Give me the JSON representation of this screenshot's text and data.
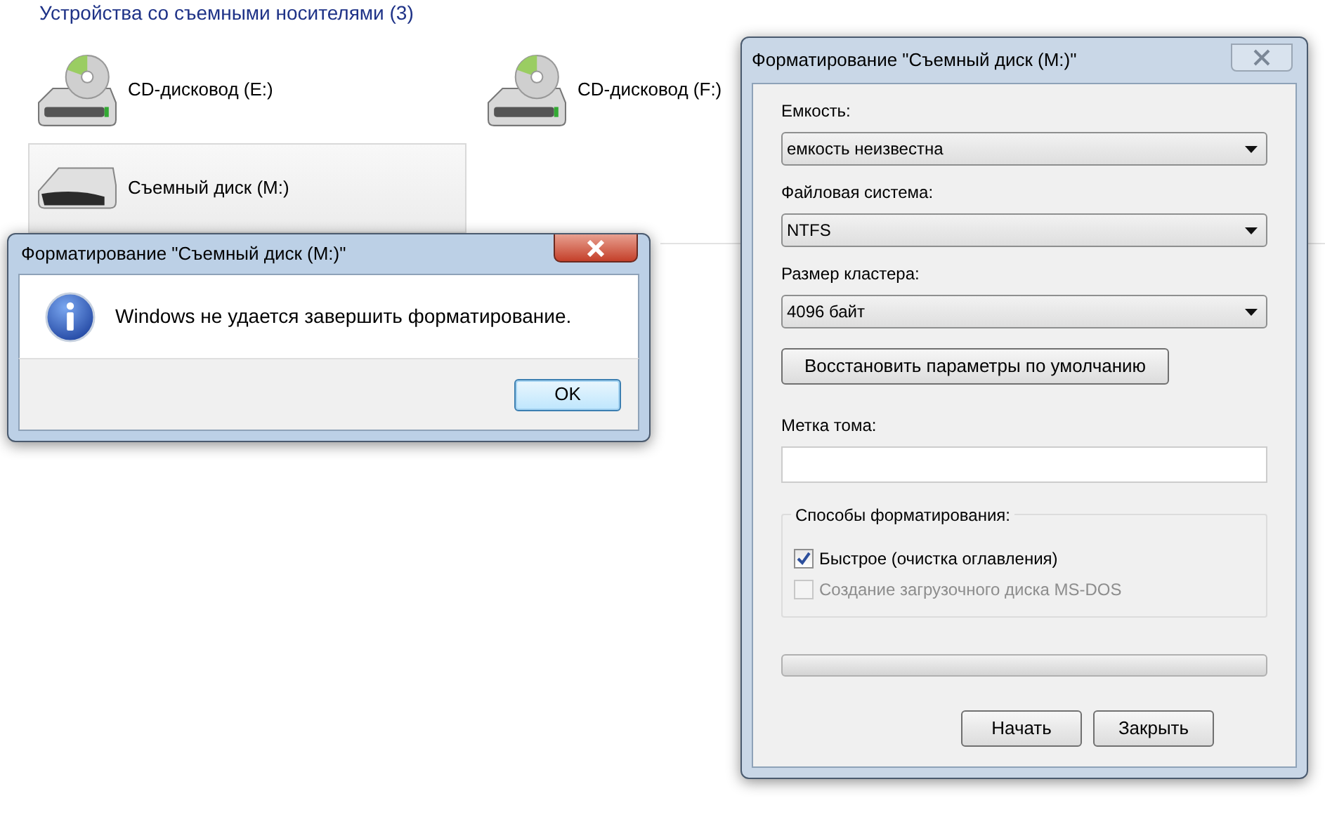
{
  "explorer": {
    "group_header": "Устройства со съемными носителями (3)",
    "drives": [
      {
        "kind": "cd",
        "label": "CD-дисковод (E:)",
        "selected": false
      },
      {
        "kind": "cd",
        "label": "CD-дисковод (F:)",
        "selected": false
      },
      {
        "kind": "removable",
        "label": "Съемный диск (M:)",
        "selected": true
      }
    ]
  },
  "message_box": {
    "title": "Форматирование \"Съемный диск (M:)\"",
    "message": "Windows не удается завершить форматирование.",
    "button": "OK"
  },
  "format_dialog": {
    "title": "Форматирование \"Съемный диск (M:)\"",
    "fields": [
      {
        "label": "Емкость:",
        "value": "емкость неизвестна"
      },
      {
        "label": "Файловая система:",
        "value": "NTFS"
      },
      {
        "label": "Размер кластера:",
        "value": "4096 байт"
      }
    ],
    "restore_button": "Восстановить параметры по умолчанию",
    "volume_label": {
      "label": "Метка тома:"
    },
    "options": {
      "title": "Способы форматирования:",
      "items": [
        {
          "label": "Быстрое (очистка оглавления)",
          "checked": true,
          "disabled": false
        },
        {
          "label": "Создание загрузочного диска MS-DOS",
          "checked": false,
          "disabled": true
        }
      ]
    },
    "progress": {
      "level": 0
    },
    "buttons": [
      "Начать",
      "Закрыть"
    ]
  }
}
